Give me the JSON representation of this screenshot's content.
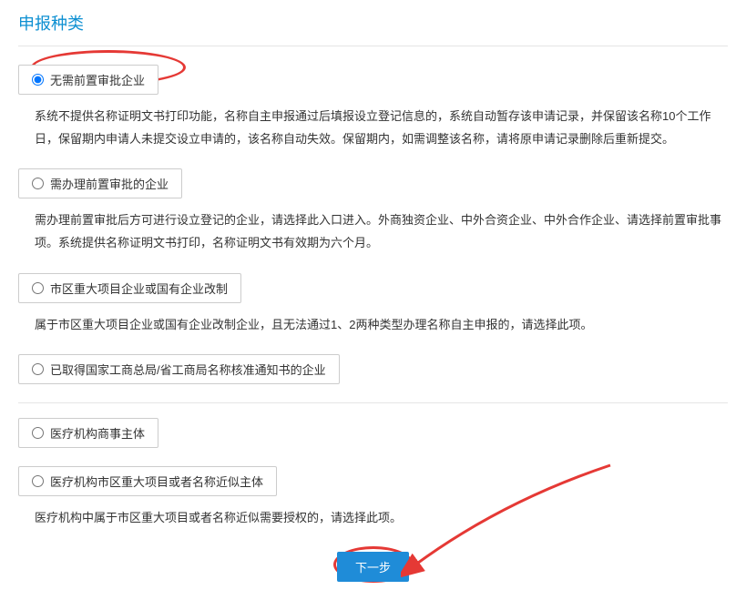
{
  "pageTitle": "申报种类",
  "options": {
    "opt1": {
      "label": "无需前置审批企业",
      "desc": "系统不提供名称证明文书打印功能，名称自主申报通过后填报设立登记信息的，系统自动暂存该申请记录，并保留该名称10个工作日，保留期内申请人未提交设立申请的，该名称自动失效。保留期内，如需调整该名称，请将原申请记录删除后重新提交。"
    },
    "opt2": {
      "label": "需办理前置审批的企业",
      "desc": "需办理前置审批后方可进行设立登记的企业，请选择此入口进入。外商独资企业、中外合资企业、中外合作企业、请选择前置审批事项。系统提供名称证明文书打印，名称证明文书有效期为六个月。"
    },
    "opt3": {
      "label": "市区重大项目企业或国有企业改制",
      "desc": "属于市区重大项目企业或国有企业改制企业，且无法通过1、2两种类型办理名称自主申报的，请选择此项。"
    },
    "opt4": {
      "label": "已取得国家工商总局/省工商局名称核准通知书的企业"
    },
    "opt5": {
      "label": "医疗机构商事主体"
    },
    "opt6": {
      "label": "医疗机构市区重大项目或者名称近似主体",
      "desc": "医疗机构中属于市区重大项目或者名称近似需要授权的，请选择此项。"
    }
  },
  "nextBtn": "下一步"
}
